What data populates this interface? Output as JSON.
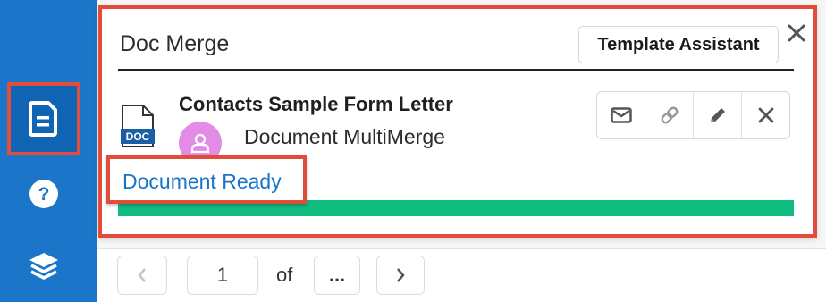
{
  "sidebar": {
    "items": [
      {
        "icon": "document-icon",
        "active": true
      },
      {
        "icon": "help-icon",
        "active": false
      },
      {
        "icon": "layers-icon",
        "active": false
      }
    ]
  },
  "panel": {
    "title": "Doc Merge",
    "template_assistant_label": "Template Assistant",
    "item": {
      "title": "Contacts Sample Form Letter",
      "subtitle": "Document MultiMerge",
      "file_type": "DOC",
      "status": "Document Ready",
      "progress": 1.0
    },
    "actions": [
      "mail-icon",
      "link-icon",
      "pencil-icon",
      "close-icon"
    ]
  },
  "pagination": {
    "current_page": "1",
    "of_label": "of",
    "total_pages": "..."
  },
  "colors": {
    "sidebar": "#1b76c9",
    "highlight": "#e24c3b",
    "status": "#1774c7",
    "progress": "#0fbd7f",
    "avatar": "#e28ce6"
  }
}
